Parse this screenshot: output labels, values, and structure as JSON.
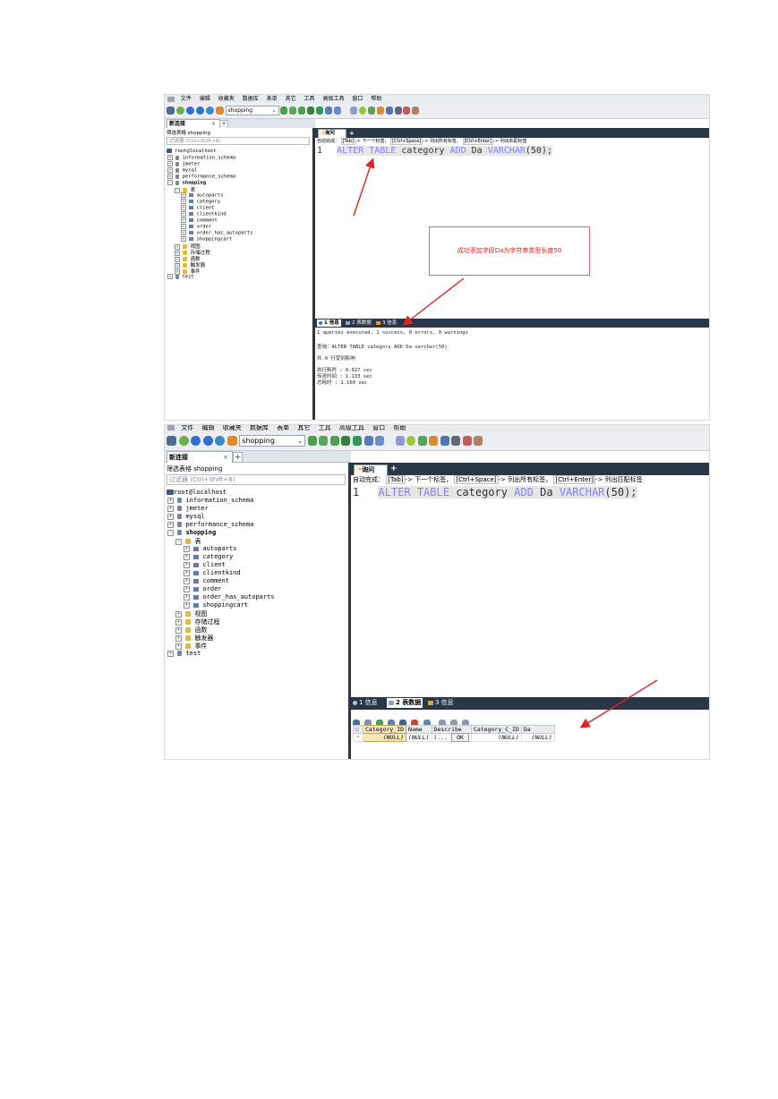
{
  "menu": [
    "文件",
    "编辑",
    "收藏夹",
    "数据库",
    "表单",
    "其它",
    "工具",
    "高级工具",
    "窗口",
    "帮助"
  ],
  "db_select": "shopping",
  "connection_tab": "新连接",
  "connection_tab_close": "×",
  "add_tab": "+",
  "object_browser": {
    "filter_title": "筛选表格 shopping",
    "filter_placeholder": "过滤器 (Ctrl+Shift+B)",
    "root": "root@localhost",
    "databases": [
      "information_schema",
      "jmeter",
      "mysql",
      "performance_schema",
      "shopping",
      "test"
    ],
    "tables_folder": "表",
    "tables": [
      "autoparts",
      "category",
      "client",
      "clientkind",
      "comment",
      "order",
      "order_has_autoparts",
      "shoppingcart"
    ],
    "folders": [
      "视图",
      "存储过程",
      "函数",
      "触发器",
      "事件"
    ]
  },
  "query_tab": "询问",
  "hint": {
    "prefix": "自动完成：",
    "k1": "[Tab]",
    "t1": "-> 下一个标签，",
    "k2": "[Ctrl+Space]",
    "t2": "-> 列出所有标签，",
    "k3": "[Ctrl+Enter]",
    "t3": "-> 列出匹配标签"
  },
  "editor": {
    "line": "1",
    "alter": "ALTER",
    "table": "TABLE",
    "name": "category",
    "add": "ADD",
    "col": "Da",
    "type": "VARCHAR",
    "len": "(50);"
  },
  "result_tabs": [
    "1 信息",
    "2 表数据",
    "3 信息"
  ],
  "messages": {
    "summary": "1 queries executed, 1 success, 0 errors, 0 warnings",
    "query": "查询：ALTER TABLE category ADD Da varchar(50)",
    "affected": "共 0 行受到影响",
    "exec_time": "执行耗时   : 0.027 sec",
    "transfer_time": "传送时间   : 1.133 sec",
    "total_time": "总耗时     : 1.160 sec"
  },
  "annotation": "成功添加字段Da为字符串类型长度50",
  "grid": {
    "columns": [
      "Category_ID",
      "Name",
      "Describe",
      "Category_C_ID",
      "Da"
    ],
    "row": [
      "(NULL)",
      "(NULL)",
      "(...",
      "OK",
      "(NULL)",
      "(NULL)"
    ],
    "row_marker": "*"
  }
}
